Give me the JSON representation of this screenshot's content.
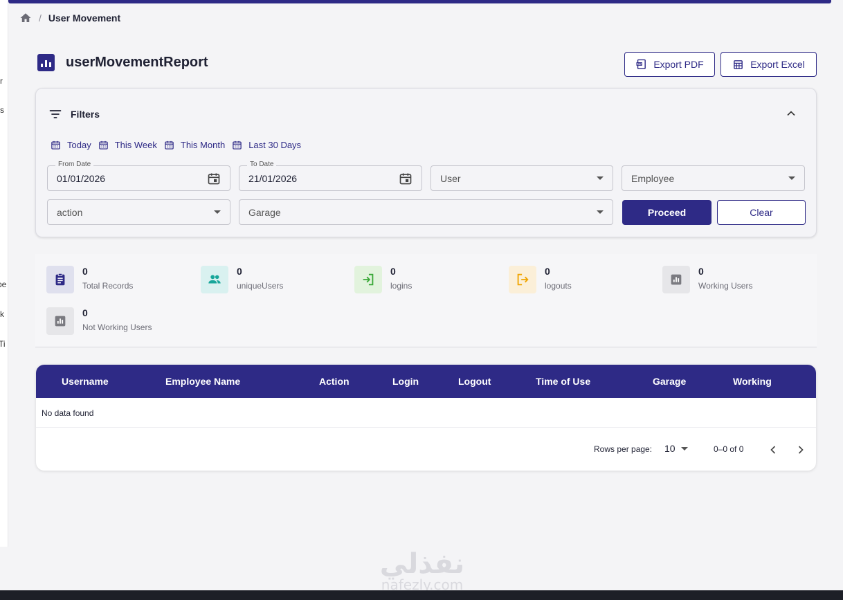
{
  "side_fragments": [
    "r",
    "s",
    "pe",
    "rk",
    "Ti"
  ],
  "breadcrumb": {
    "separator": "/",
    "current": "User Movement"
  },
  "page": {
    "title": "userMovementReport"
  },
  "actions": {
    "export_pdf": "Export PDF",
    "export_excel": "Export Excel"
  },
  "filters": {
    "title": "Filters",
    "quick_ranges": [
      "Today",
      "This Week",
      "This Month",
      "Last 30 Days"
    ],
    "from_date": {
      "label": "From Date",
      "value": "01/01/2026"
    },
    "to_date": {
      "label": "To Date",
      "value": "21/01/2026"
    },
    "user": {
      "placeholder": "User"
    },
    "employee": {
      "placeholder": "Employee"
    },
    "action": {
      "placeholder": "action"
    },
    "garage": {
      "placeholder": "Garage"
    },
    "proceed": "Proceed",
    "clear": "Clear"
  },
  "stats": [
    {
      "value": "0",
      "label": "Total Records",
      "icon": "clipboard-icon"
    },
    {
      "value": "0",
      "label": "uniqueUsers",
      "icon": "people-icon"
    },
    {
      "value": "0",
      "label": "logins",
      "icon": "login-icon"
    },
    {
      "value": "0",
      "label": "logouts",
      "icon": "logout-icon"
    },
    {
      "value": "0",
      "label": "Working Users",
      "icon": "bar-chart-icon"
    },
    {
      "value": "0",
      "label": "Not Working Users",
      "icon": "bar-chart-icon"
    }
  ],
  "table": {
    "columns": [
      "Username",
      "Employee Name",
      "Action",
      "Login",
      "Logout",
      "Time of Use",
      "Garage",
      "Working"
    ],
    "empty_text": "No data found",
    "pagination": {
      "rows_per_page_label": "Rows per page:",
      "rows_per_page": "10",
      "range": "0–0 of 0"
    }
  },
  "watermark": {
    "arabic": "نفذلي",
    "latin": "nafezly.com"
  },
  "colors": {
    "primary": "#2e2a86",
    "background": "#f4f4f6"
  }
}
